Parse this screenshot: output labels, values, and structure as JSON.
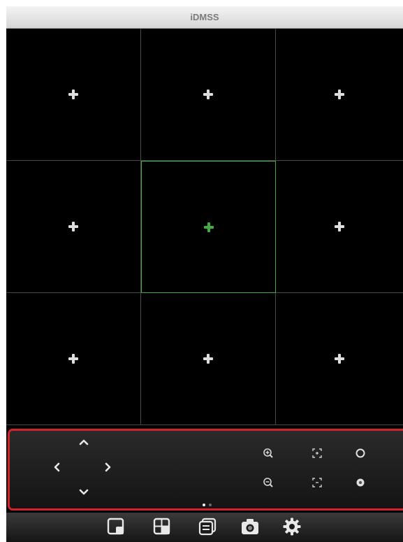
{
  "app": {
    "title": "iDMSS"
  },
  "grid": {
    "rows": 3,
    "columns": 3,
    "selected_cell": 4,
    "cells": [
      {
        "action": "add-device"
      },
      {
        "action": "add-device"
      },
      {
        "action": "add-device"
      },
      {
        "action": "add-device"
      },
      {
        "action": "add-device"
      },
      {
        "action": "add-device"
      },
      {
        "action": "add-device"
      },
      {
        "action": "add-device"
      },
      {
        "action": "add-device"
      }
    ]
  },
  "ptz_panel": {
    "direction_icons": [
      "arrow-up-icon",
      "arrow-left-icon",
      "arrow-right-icon",
      "arrow-down-icon"
    ],
    "zoom_icons": [
      "zoom-in-icon",
      "zoom-out-icon"
    ],
    "focus_icons": [
      "focus-near-icon",
      "focus-far-icon"
    ],
    "iris_icons": [
      "iris-open-icon",
      "iris-close-icon"
    ],
    "page_dots": {
      "count": 2,
      "active": 0
    }
  },
  "tab_bar": {
    "tabs": [
      {
        "icon": "single-view-icon"
      },
      {
        "icon": "multi-view-icon"
      },
      {
        "icon": "device-list-icon"
      },
      {
        "icon": "snapshot-camera-icon"
      },
      {
        "icon": "settings-gear-icon"
      }
    ]
  },
  "colors": {
    "selected_cell": "#3fae3f",
    "panel_highlight": "#d2232a",
    "icon_default": "#e8e8e8",
    "title_text": "#7b7b7b"
  }
}
